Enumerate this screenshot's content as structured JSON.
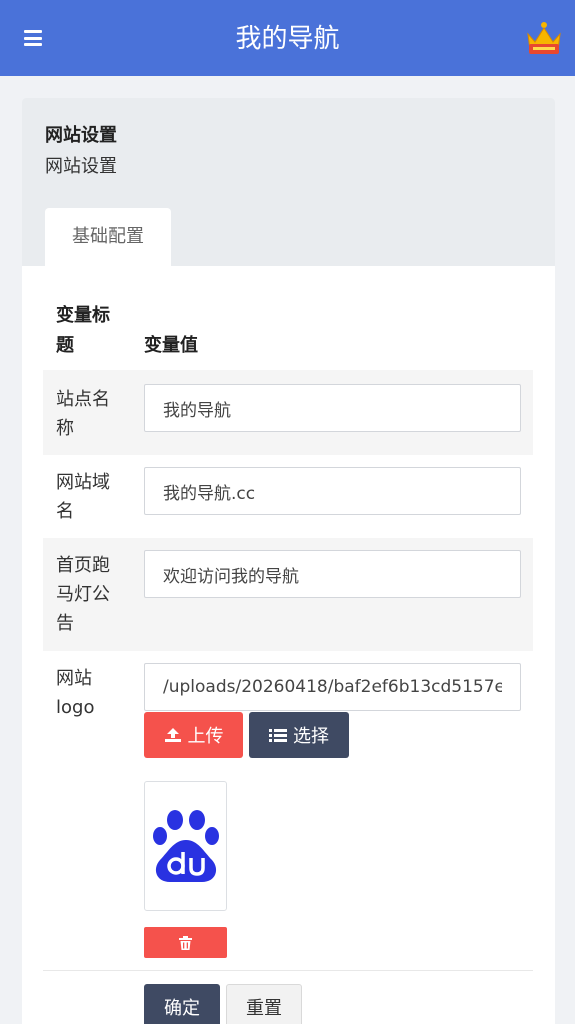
{
  "header": {
    "title": "我的导航"
  },
  "panel": {
    "title": "网站设置",
    "subtitle": "网站设置",
    "tab": "基础配置"
  },
  "table": {
    "col_name": "变量标题",
    "col_value": "变量值"
  },
  "fields": [
    {
      "label": "站点名称",
      "value": "我的导航"
    },
    {
      "label": "网站域名",
      "value": "我的导航.cc"
    },
    {
      "label": "首页跑马灯公告",
      "value": "欢迎访问我的导航"
    },
    {
      "label": "网站logo",
      "value": "/uploads/20260418/baf2ef6b13cd5157e"
    }
  ],
  "actions": {
    "upload": "上传",
    "choose": "选择",
    "confirm": "确定",
    "reset": "重置"
  },
  "icons": {
    "menu": "hamburger-icon",
    "avatar": "crown-icon",
    "upload": "upload-icon",
    "choose": "list-icon",
    "delete": "trash-icon",
    "logo": "baidu-paw-icon"
  },
  "colors": {
    "header": "#4a72d9",
    "danger": "#f5524c",
    "dark": "#3f4a63",
    "logo": "#2932e1"
  }
}
